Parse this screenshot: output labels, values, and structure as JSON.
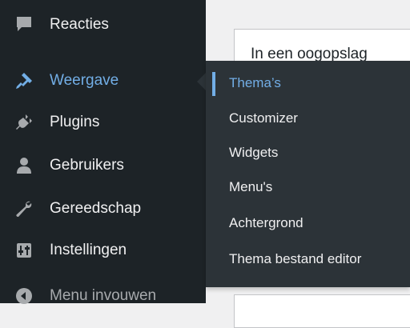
{
  "admin_menu": {
    "items": [
      {
        "label": "Reacties",
        "icon": "comments-icon"
      },
      {
        "label": "Weergave",
        "icon": "appearance-icon",
        "current": true
      },
      {
        "label": "Plugins",
        "icon": "plugins-icon"
      },
      {
        "label": "Gebruikers",
        "icon": "users-icon"
      },
      {
        "label": "Gereedschap",
        "icon": "tools-icon"
      },
      {
        "label": "Instellingen",
        "icon": "settings-icon"
      },
      {
        "label": "Menu invouwen",
        "icon": "collapse-icon"
      }
    ]
  },
  "submenu": {
    "items": [
      {
        "label": "Thema’s",
        "active": true
      },
      {
        "label": "Customizer"
      },
      {
        "label": "Widgets"
      },
      {
        "label": "Menu's"
      },
      {
        "label": "Achtergrond"
      },
      {
        "label": "Thema bestand editor"
      }
    ]
  },
  "dashboard": {
    "widget_title": "In een oogopslag"
  },
  "colors": {
    "sidebar_bg": "#1d2327",
    "submenu_bg": "#2c3338",
    "accent": "#72aee6",
    "text": "#f0f0f1",
    "muted": "#a7aaad"
  }
}
